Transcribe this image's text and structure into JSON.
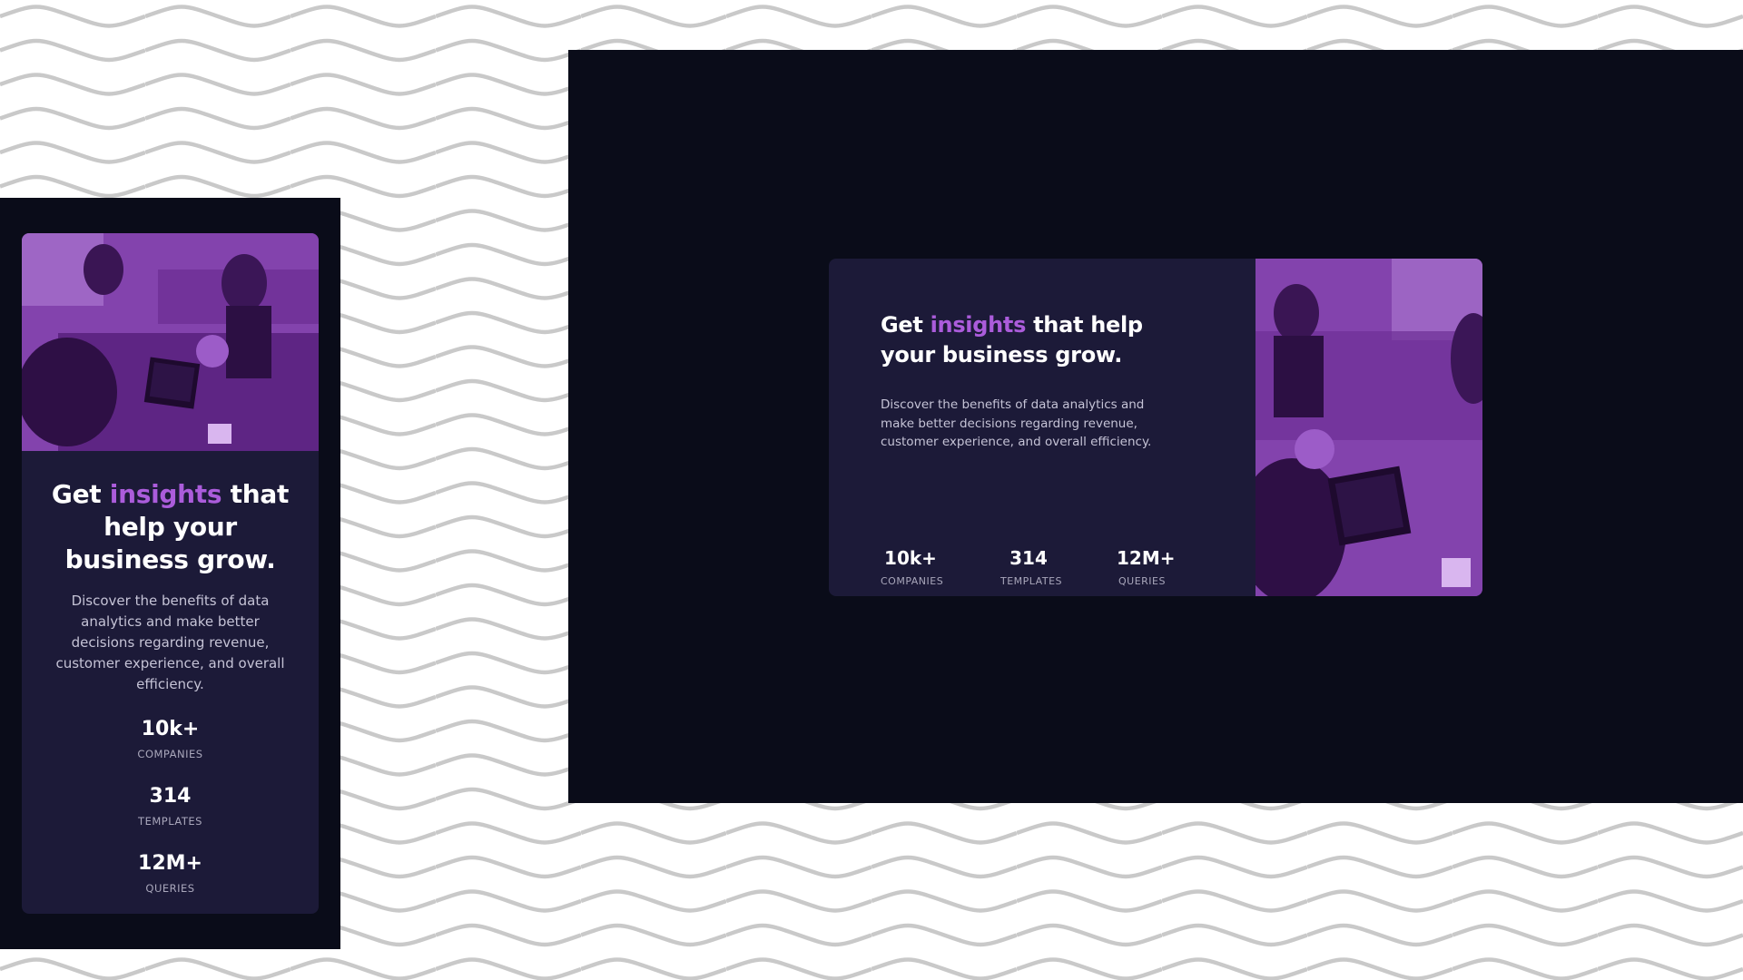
{
  "heading": {
    "prefix": "Get ",
    "accent_word": "insights",
    "suffix": " that help your business grow."
  },
  "description": "Discover the benefits of data analytics and make better decisions regarding revenue, customer experience, and overall efficiency.",
  "stats": [
    {
      "value": "10k+",
      "label": "COMPANIES"
    },
    {
      "value": "314",
      "label": "TEMPLATES"
    },
    {
      "value": "12M+",
      "label": "QUERIES"
    }
  ],
  "colors": {
    "page_background": "#0a0c19",
    "card_background": "#1c1a38",
    "accent": "#ab5cdb",
    "heading_text": "#ffffff",
    "body_text": "#c5c3d6",
    "label_text": "#a9a7bb"
  },
  "image": {
    "subject": "people working at a table with laptops, purple overlay"
  }
}
